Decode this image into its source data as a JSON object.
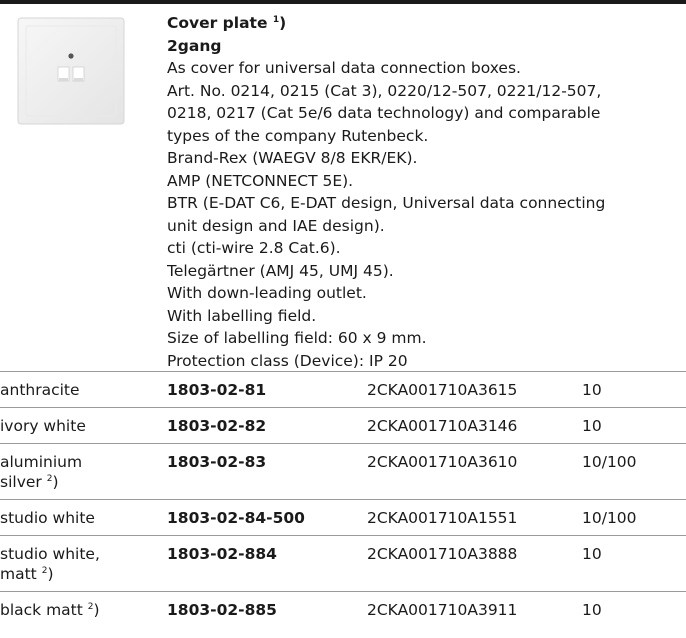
{
  "product": {
    "title": "Cover plate",
    "title_note": "1",
    "title_suffix": ")",
    "subtitle": "2gang",
    "description_lines": [
      "As cover for universal data connection boxes.",
      "Art. No. 0214, 0215 (Cat 3), 0220/12-507, 0221/12-507,",
      "0218, 0217 (Cat 5e/6 data technology) and comparable",
      "types of the company Rutenbeck.",
      "Brand-Rex (WAEGV 8/8 EKR/EK).",
      "AMP (NETCONNECT 5E).",
      "BTR (E-DAT C6, E-DAT design, Universal data connecting",
      "unit design and IAE design).",
      "cti (cti-wire 2.8 Cat.6).",
      "Telegärtner (AMJ 45, UMJ 45).",
      "With down-leading outlet.",
      "With labelling field.",
      "Size of labelling field: 60 x 9 mm.",
      "Protection class (Device): IP 20"
    ]
  },
  "variants": [
    {
      "colour_lines": [
        "anthracite"
      ],
      "note": "",
      "article": "1803-02-81",
      "order_code": "2CKA001710A3615",
      "pack": "10"
    },
    {
      "colour_lines": [
        "ivory white"
      ],
      "note": "",
      "article": "1803-02-82",
      "order_code": "2CKA001710A3146",
      "pack": "10"
    },
    {
      "colour_lines": [
        "aluminium",
        "silver"
      ],
      "note": "2",
      "article": "1803-02-83",
      "order_code": "2CKA001710A3610",
      "pack": "10/100"
    },
    {
      "colour_lines": [
        "studio white"
      ],
      "note": "",
      "article": "1803-02-84-500",
      "order_code": "2CKA001710A1551",
      "pack": "10/100"
    },
    {
      "colour_lines": [
        "studio white,",
        "matt"
      ],
      "note": "2",
      "article": "1803-02-884",
      "order_code": "2CKA001710A3888",
      "pack": "10"
    },
    {
      "colour_lines": [
        "black matt"
      ],
      "note": "2",
      "article": "1803-02-885",
      "order_code": "2CKA001710A3911",
      "pack": "10"
    }
  ]
}
